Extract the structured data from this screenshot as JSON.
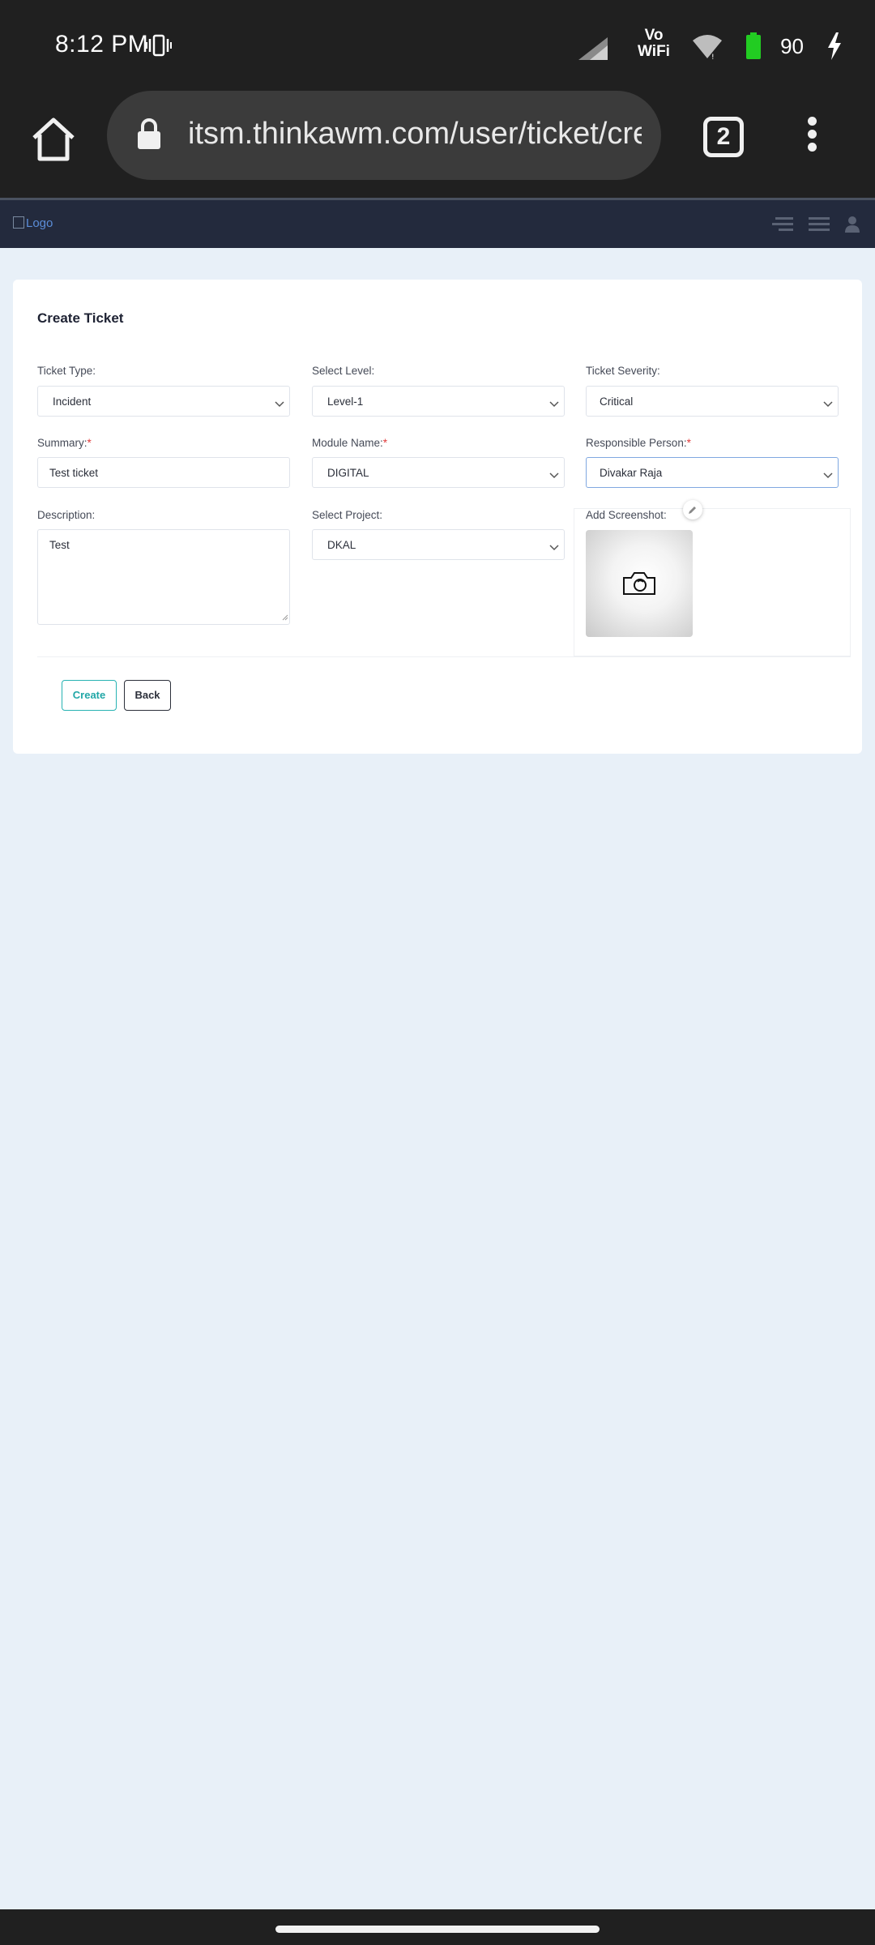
{
  "status_bar": {
    "time": "8:12 PM",
    "vowifi_line1": "Vo",
    "vowifi_line2": "WiFi",
    "battery_level": "90",
    "icons": [
      "vibrate-icon",
      "signal-icon",
      "wifi-icon",
      "battery-icon",
      "charging-icon"
    ]
  },
  "browser": {
    "url": "itsm.thinkawm.com/user/ticket/create",
    "tab_count": "2"
  },
  "header": {
    "logo_alt": "Logo"
  },
  "form": {
    "title": "Create Ticket",
    "ticket_type": {
      "label": "Ticket Type:",
      "value": "Incident"
    },
    "select_level": {
      "label": "Select Level:",
      "value": "Level-1"
    },
    "ticket_severity": {
      "label": "Ticket Severity:",
      "value": "Critical"
    },
    "summary": {
      "label": "Summary:",
      "required": "*",
      "value": "Test ticket"
    },
    "module_name": {
      "label": "Module Name:",
      "required": "*",
      "value": "DIGITAL"
    },
    "responsible_person": {
      "label": "Responsible Person:",
      "required": "*",
      "value": "Divakar Raja"
    },
    "description": {
      "label": "Description:",
      "value": "Test"
    },
    "select_project": {
      "label": "Select Project:",
      "value": "DKAL"
    },
    "add_screenshot": {
      "label": "Add Screenshot:"
    },
    "create_label": "Create",
    "back_label": "Back"
  },
  "colors": {
    "header_bg": "#232a3d",
    "page_bg": "#e8f0f8",
    "create_accent": "#21a7a7",
    "required_mark": "#e03a3a",
    "battery_fill": "#22cc22"
  }
}
